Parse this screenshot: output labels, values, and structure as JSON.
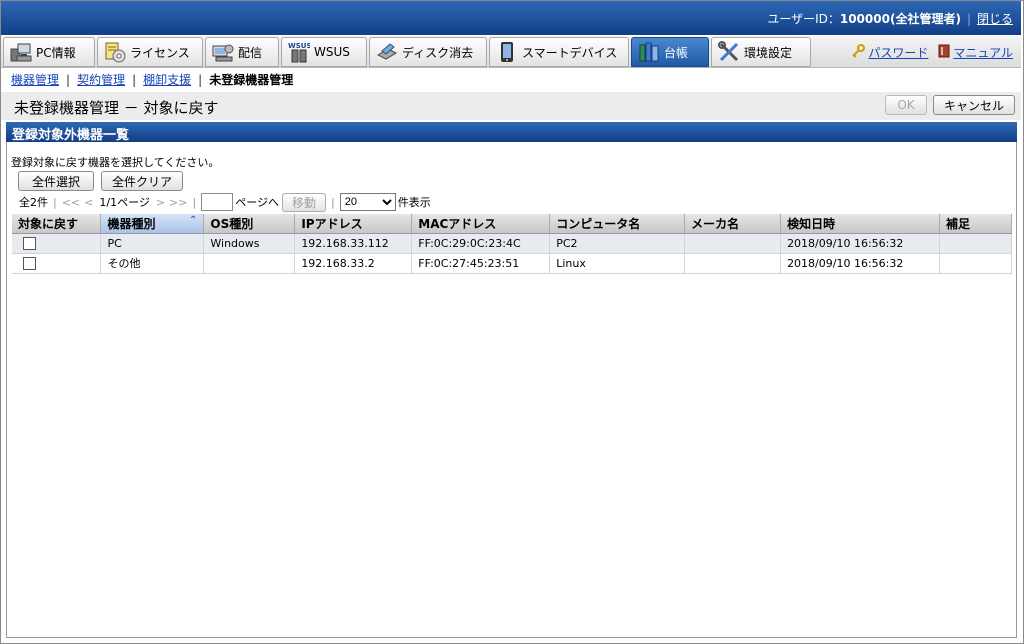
{
  "header": {
    "user_label": "ユーザーID：",
    "user_value": "100000(全社管理者)",
    "close_label": "閉じる"
  },
  "nav": {
    "tabs": [
      {
        "label": "PC情報",
        "icon": "pc-info-icon"
      },
      {
        "label": "ライセンス",
        "icon": "license-icon"
      },
      {
        "label": "配信",
        "icon": "distribution-icon"
      },
      {
        "label": "WSUS",
        "icon": "wsus-icon",
        "icon_text": "WSUS"
      },
      {
        "label": "ディスク消去",
        "icon": "disk-erase-icon"
      },
      {
        "label": "スマートデバイス",
        "icon": "smart-device-icon"
      },
      {
        "label": "台帳",
        "icon": "ledger-icon"
      },
      {
        "label": "環境設定",
        "icon": "settings-tools-icon"
      }
    ],
    "active_tab": "台帳",
    "password_label": "パスワード",
    "manual_label": "マニュアル"
  },
  "breadcrumb": {
    "items": [
      "機器管理",
      "契約管理",
      "棚卸支援"
    ],
    "current": "未登録機器管理"
  },
  "page": {
    "title": "未登録機器管理 － 対象に戻す",
    "ok_label": "OK",
    "cancel_label": "キャンセル"
  },
  "section": {
    "title": "登録対象外機器一覧",
    "instruction": "登録対象に戻す機器を選択してください。",
    "select_all_label": "全件選択",
    "clear_all_label": "全件クリア"
  },
  "pager": {
    "total": "全2件",
    "first": "<<",
    "prev": "<",
    "page_info": "1/1ページ",
    "next": ">",
    "last": ">>",
    "page_input_value": "",
    "page_suffix": "ページへ",
    "go_label": "移動",
    "per_page": "20",
    "per_page_suffix": "件表示"
  },
  "table": {
    "columns": [
      "対象に戻す",
      "機器種別",
      "OS種別",
      "IPアドレス",
      "MACアドレス",
      "コンピュータ名",
      "メーカ名",
      "検知日時",
      "補足"
    ],
    "sorted_column": "機器種別",
    "rows": [
      {
        "type": "PC",
        "os": "Windows",
        "ip": "192.168.33.112",
        "mac": "FF:0C:29:0C:23:4C",
        "computer": "PC2",
        "maker": "",
        "detected": "2018/09/10 16:56:32",
        "note": ""
      },
      {
        "type": "その他",
        "os": "",
        "ip": "192.168.33.2",
        "mac": "FF:0C:27:45:23:51",
        "computer": "Linux",
        "maker": "",
        "detected": "2018/09/10 16:56:32",
        "note": ""
      }
    ]
  },
  "colors": {
    "header_blue": "#1f5aa8",
    "link": "#1646b4",
    "row_stripe": "#e7ebf1"
  }
}
